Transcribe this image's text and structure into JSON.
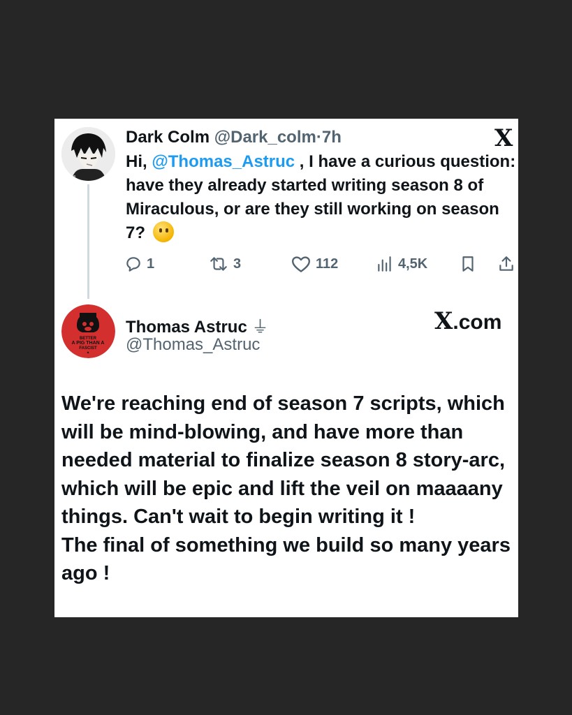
{
  "tweet": {
    "display_name": "Dark Colm",
    "handle": "@Dark_colm",
    "separator": "·",
    "time": "7h",
    "x_logo": "X",
    "text_before": "Hi, ",
    "mention": "@Thomas_Astruc",
    "text_after": " , I have a curious question: have they already started writing season 8 of Miraculous, or are they still working on season 7?",
    "emoji": "thinking-face-emoji",
    "stats": {
      "replies": "1",
      "reposts": "3",
      "likes": "112",
      "views": "4,5K"
    }
  },
  "reply": {
    "display_name": "Thomas Astruc",
    "affiliation_glyph": "⏚",
    "handle": "@Thomas_Astruc",
    "site_logo": "X",
    "site_suffix": ".com",
    "avatar_text": "BETTER A PIG THAN A FASCIST",
    "paragraph1": "We're reaching end of season 7 scripts, which will be mind-blowing, and have more than needed material to finalize season 8 story-arc, which will be epic and lift the veil on maaaany things. Can't wait to begin writing it !",
    "paragraph2": "The final of something we build so many years ago !"
  },
  "colors": {
    "background": "#262626",
    "card": "#ffffff",
    "text": "#0f1419",
    "muted": "#536471",
    "link": "#1d9bf0",
    "avatar_red": "#d32f2f"
  }
}
